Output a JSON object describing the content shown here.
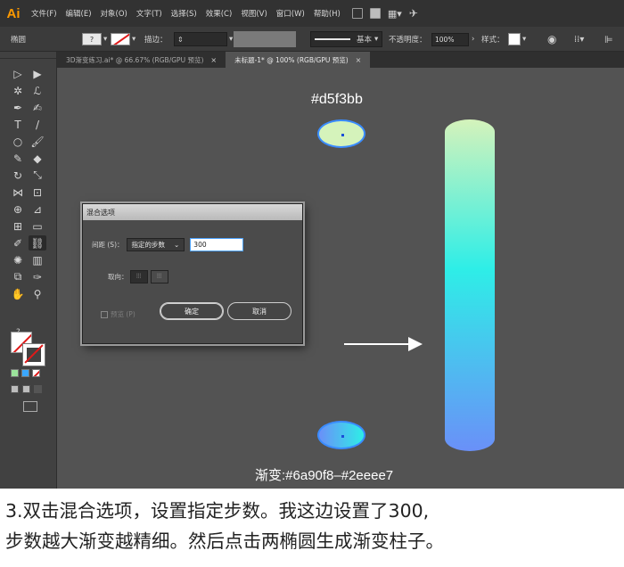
{
  "menubar": {
    "logo": "Ai",
    "items": [
      "文件(F)",
      "编辑(E)",
      "对象(O)",
      "文字(T)",
      "选择(S)",
      "效果(C)",
      "视图(V)",
      "窗口(W)",
      "帮助(H)"
    ],
    "br_label": "Br",
    "st_label": "St"
  },
  "controlbar": {
    "object_label": "椭圆",
    "stroke_label": "描边：",
    "stroke_weight_value": "",
    "stroke_profile": "基本",
    "opacity_label": "不透明度：",
    "opacity_value": "100%",
    "style_label": "样式："
  },
  "tabs": [
    {
      "label": "3D渐变练习.ai* @ 66.67% (RGB/GPU 预览)"
    },
    {
      "label": "未标题-1* @ 100% (RGB/GPU 预览)"
    }
  ],
  "canvas": {
    "top_color_label": "#d5f3bb",
    "gradient_label": "渐变:#6a90f8–#2eeee7"
  },
  "colors": {
    "top_ellipse": "#d5f3bb",
    "bottom_ellipse_start": "#6a90f8",
    "bottom_ellipse_end": "#2eeee7",
    "cylinder_top": "#d5f3bb",
    "cylinder_mid": "#2eeee7",
    "cylinder_bottom": "#6a90f8"
  },
  "dialog": {
    "title": "混合选项",
    "spacing_label": "间距 (S)：",
    "spacing_mode": "指定的步数",
    "steps_value": "300",
    "orientation_label": "取向：",
    "preview_label": "预览 (P)",
    "ok_label": "确定",
    "cancel_label": "取消"
  },
  "caption": {
    "line1": "3.双击混合选项，设置指定步数。我这边设置了300,",
    "line2": "步数越大渐变越精细。然后点击两椭圆生成渐变柱子。"
  }
}
